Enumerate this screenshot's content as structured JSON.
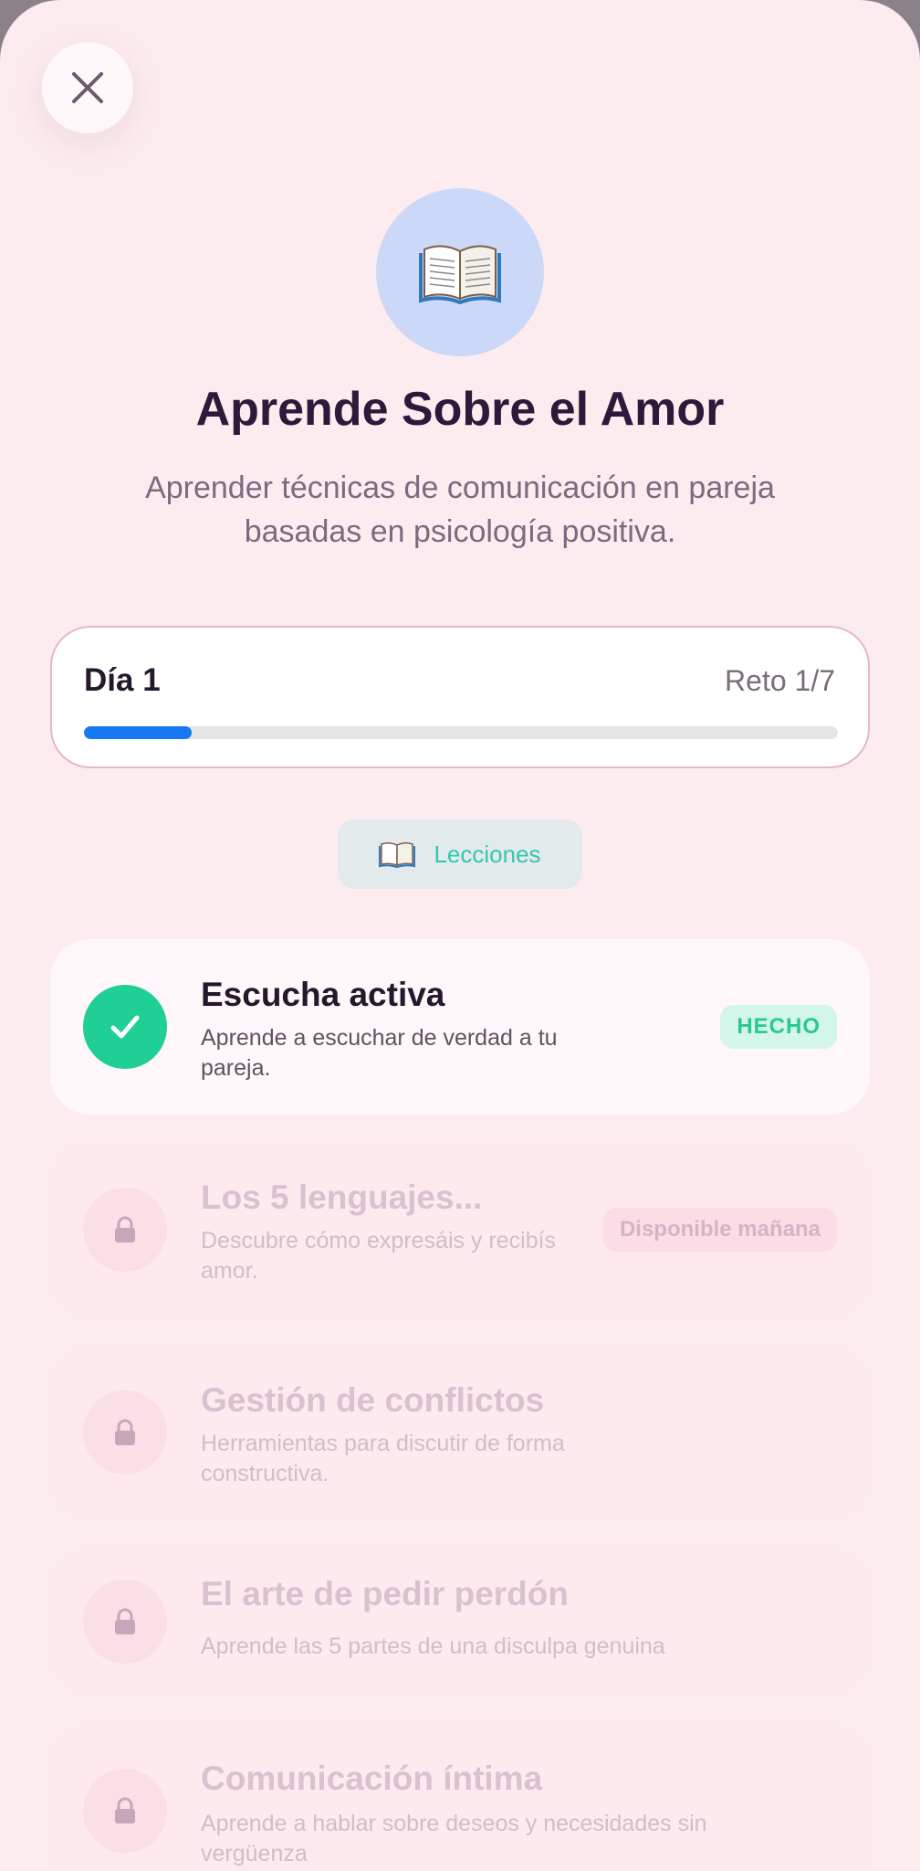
{
  "sheet": {
    "close_icon": "close-icon",
    "hero_icon": "📖",
    "title": "Aprende Sobre el Amor",
    "subtitle": "Aprender técnicas de comunicación en pareja basadas en psicología positiva."
  },
  "progress": {
    "day_label": "Día 1",
    "challenge_label": "Reto 1/7",
    "fraction": 0.14285
  },
  "lessons_chip": {
    "icon": "📖",
    "label": "Lecciones"
  },
  "lessons": [
    {
      "title": "Escucha activa",
      "description": "Aprende a escuchar de verdad a tu pareja.",
      "status": "HECHO",
      "state": "done"
    },
    {
      "title": "Los 5 lenguajes...",
      "description": "Descubre cómo expresáis y recibís amor.",
      "status": "Disponible mañana",
      "state": "next"
    },
    {
      "title": "Gestión de conflictos",
      "description": "Herramientas para discutir de forma constructiva.",
      "status": "",
      "state": "locked"
    },
    {
      "title": "El arte de pedir perdón",
      "description": "Aprende las 5 partes de una disculpa genuina",
      "status": "",
      "state": "locked"
    },
    {
      "title": "Comunicación íntima",
      "description": "Aprende a hablar sobre deseos y necesidades sin vergüenza",
      "status": "",
      "state": "locked"
    }
  ],
  "colors": {
    "accent_progress": "#1877f2",
    "done_green": "#1fcf96",
    "chip_text": "#35c7ab",
    "background": "#fdecef"
  }
}
